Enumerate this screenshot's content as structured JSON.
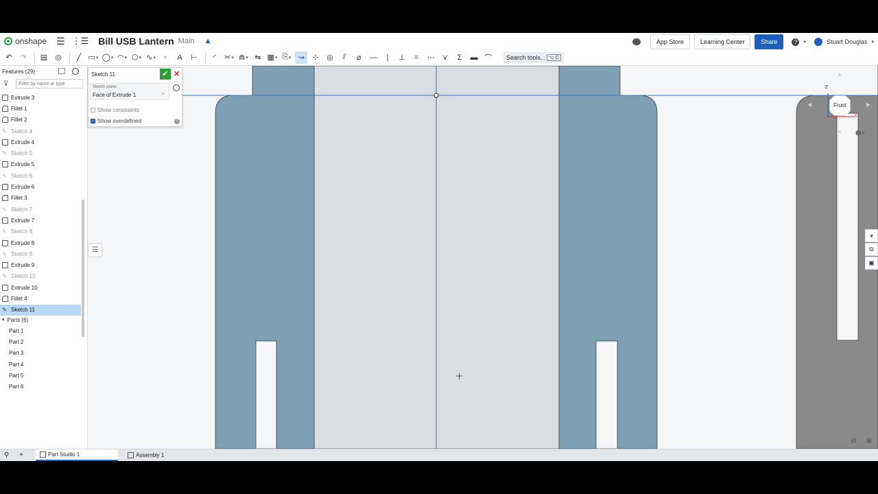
{
  "app": {
    "brand": "onshape"
  },
  "document": {
    "title": "Bill USB Lantern",
    "branch": "Main"
  },
  "topbar": {
    "app_store": "App Store",
    "learning_center": "Learning Center",
    "share": "Share",
    "user": "Stuart Douglas"
  },
  "toolbar": {
    "search_label": "Search tools...",
    "search_shortcut": "⌥ C"
  },
  "features": {
    "header": "Features (29)",
    "filter_placeholder": "Filter by name or type",
    "items": [
      {
        "label": "Extrude 3",
        "kind": "extrude"
      },
      {
        "label": "Fillet 1",
        "kind": "fillet"
      },
      {
        "label": "Fillet 2",
        "kind": "fillet"
      },
      {
        "label": "Sketch 4",
        "kind": "sketch"
      },
      {
        "label": "Extrude 4",
        "kind": "extrude"
      },
      {
        "label": "Sketch 5",
        "kind": "sketch"
      },
      {
        "label": "Extrude 5",
        "kind": "extrude"
      },
      {
        "label": "Sketch 6",
        "kind": "sketch"
      },
      {
        "label": "Extrude 6",
        "kind": "extrude"
      },
      {
        "label": "Fillet 3",
        "kind": "fillet"
      },
      {
        "label": "Sketch 7",
        "kind": "sketch"
      },
      {
        "label": "Extrude 7",
        "kind": "extrude"
      },
      {
        "label": "Sketch 8",
        "kind": "sketch"
      },
      {
        "label": "Extrude 8",
        "kind": "extrude"
      },
      {
        "label": "Sketch 9",
        "kind": "sketch"
      },
      {
        "label": "Extrude 9",
        "kind": "extrude"
      },
      {
        "label": "Sketch 10",
        "kind": "sketch"
      },
      {
        "label": "Extrude 10",
        "kind": "extrude"
      },
      {
        "label": "Fillet 4",
        "kind": "fillet"
      },
      {
        "label": "Sketch 11",
        "kind": "sketch-active"
      }
    ],
    "parts_header": "Parts (6)",
    "parts": [
      "Part 1",
      "Part 2",
      "Part 3",
      "Part 4",
      "Part 5",
      "Part 6"
    ]
  },
  "sketch_dialog": {
    "title": "Sketch 11",
    "plane_label": "Sketch plane",
    "plane_value": "Face of Extrude 1",
    "show_constraints": "Show constraints",
    "show_constraints_checked": false,
    "show_overdefined": "Show overdefined",
    "show_overdefined_checked": true
  },
  "view_cube": {
    "face": "Front",
    "axis_z": "Z",
    "axis_x": "X"
  },
  "tabs": [
    {
      "label": "Part Studio 1",
      "active": true
    },
    {
      "label": "Assembly 1",
      "active": false
    }
  ],
  "colors": {
    "part_blue": "#7e9fb4",
    "face_light": "#d9dee3",
    "dark_part": "#8a8a8a",
    "accent": "#1e5fb8",
    "selection": "#b8d9f5"
  }
}
